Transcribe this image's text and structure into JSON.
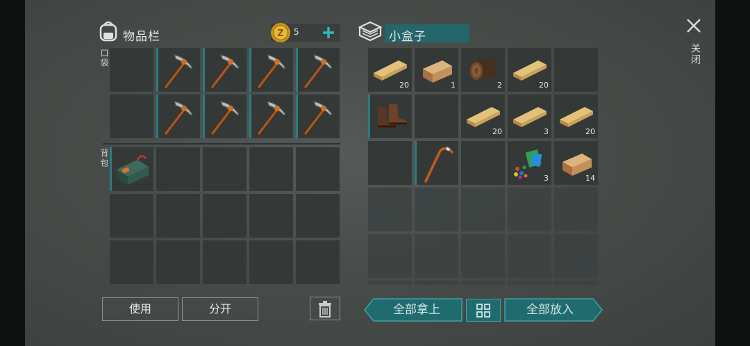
{
  "inventory": {
    "title": "物品栏",
    "coin_count": "5",
    "pocket_label": "口袋",
    "backpack_label": "背包"
  },
  "container": {
    "title": "小盒子"
  },
  "close_label": "关闭",
  "buttons": {
    "use": "使用",
    "split": "分开",
    "take_all": "全部拿上",
    "put_all": "全部放入"
  },
  "pocket_slots": [
    {
      "item": "empty",
      "count": ""
    },
    {
      "item": "pickaxe-icon",
      "count": ""
    },
    {
      "item": "pickaxe-icon",
      "count": ""
    },
    {
      "item": "pickaxe-icon",
      "count": ""
    },
    {
      "item": "pickaxe-icon",
      "count": ""
    },
    {
      "item": "empty",
      "count": ""
    },
    {
      "item": "pickaxe-icon",
      "count": ""
    },
    {
      "item": "pickaxe-icon",
      "count": ""
    },
    {
      "item": "pickaxe-icon",
      "count": ""
    },
    {
      "item": "pickaxe-icon",
      "count": ""
    }
  ],
  "container_slots": [
    {
      "item": "plank-icon",
      "count": "20"
    },
    {
      "item": "wood-block-icon",
      "count": "1"
    },
    {
      "item": "log-icon",
      "count": "2"
    },
    {
      "item": "plank-icon",
      "count": "20"
    },
    {
      "item": "empty",
      "count": ""
    },
    {
      "item": "boots-icon",
      "count": ""
    },
    {
      "item": "empty",
      "count": ""
    },
    {
      "item": "plank-icon",
      "count": "20"
    },
    {
      "item": "plank-icon",
      "count": "3"
    },
    {
      "item": "plank-icon",
      "count": "20"
    },
    {
      "item": "empty",
      "count": ""
    },
    {
      "item": "cane-icon",
      "count": ""
    },
    {
      "item": "empty",
      "count": ""
    },
    {
      "item": "scrap-icon",
      "count": "3"
    },
    {
      "item": "wood-block-icon",
      "count": "14"
    }
  ]
}
